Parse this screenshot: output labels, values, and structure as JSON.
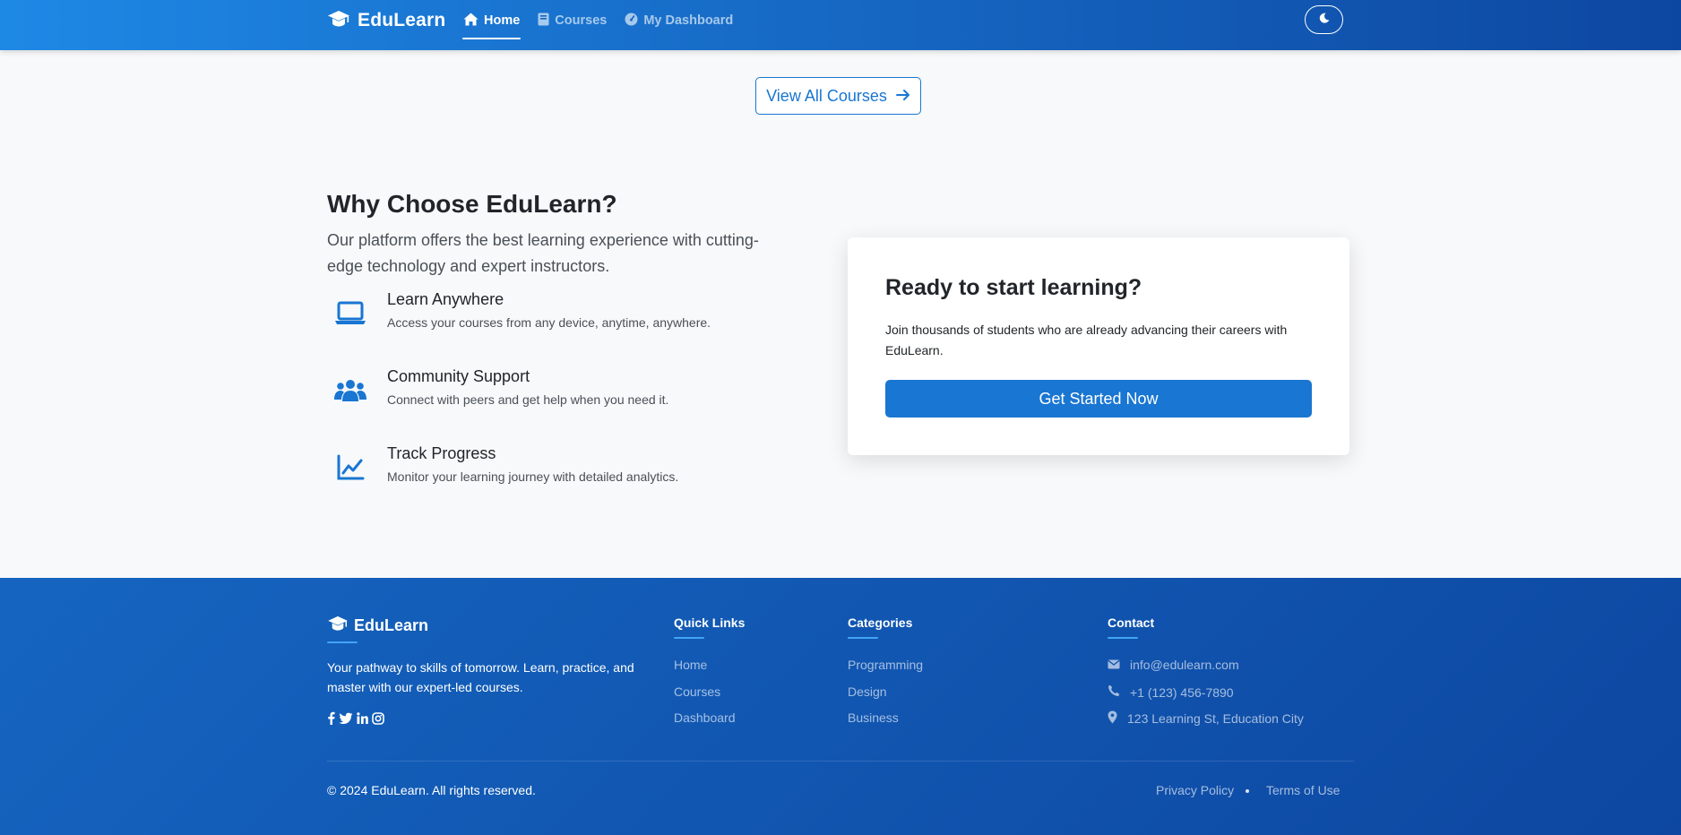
{
  "navbar": {
    "brand": "EduLearn",
    "links": [
      {
        "label": "Home",
        "icon": "home-icon",
        "active": true
      },
      {
        "label": "Courses",
        "icon": "book-icon",
        "active": false
      },
      {
        "label": "My Dashboard",
        "icon": "tachometer-icon",
        "active": false
      }
    ],
    "theme_toggle_icon": "moon-icon"
  },
  "view_all": {
    "label": "View All Courses",
    "icon": "arrow-right-icon"
  },
  "why": {
    "title": "Why Choose EduLearn?",
    "description": "Our platform offers the best learning experience with cutting-edge technology and expert instructors.",
    "features": [
      {
        "title": "Learn Anywhere",
        "description": "Access your courses from any device, anytime, anywhere.",
        "icon": "laptop-icon"
      },
      {
        "title": "Community Support",
        "description": "Connect with peers and get help when you need it.",
        "icon": "users-icon"
      },
      {
        "title": "Track Progress",
        "description": "Monitor your learning journey with detailed analytics.",
        "icon": "chart-line-icon"
      }
    ]
  },
  "cta": {
    "title": "Ready to start learning?",
    "description": "Join thousands of students who are already advancing their careers with EduLearn.",
    "button": "Get Started Now"
  },
  "footer": {
    "brand": "EduLearn",
    "tagline": "Your pathway to skills of tomorrow. Learn, practice, and master with our expert-led courses.",
    "social": [
      "facebook-icon",
      "twitter-icon",
      "linkedin-icon",
      "instagram-icon"
    ],
    "quick_links": {
      "heading": "Quick Links",
      "items": [
        "Home",
        "Courses",
        "Dashboard"
      ]
    },
    "categories": {
      "heading": "Categories",
      "items": [
        "Programming",
        "Design",
        "Business"
      ]
    },
    "contact": {
      "heading": "Contact",
      "email": "info@edulearn.com",
      "phone": "+1 (123) 456-7890",
      "address": "123 Learning St, Education City"
    },
    "copyright": "© 2024 EduLearn. All rights reserved.",
    "privacy": "Privacy Policy",
    "terms": "Terms of Use"
  },
  "colors": {
    "primary": "#1976d2",
    "nav_gradient_start": "#1e88e5",
    "nav_gradient_end": "#0d47a1",
    "footer_bg": "#1565c0",
    "accent_underline": "#42a5f5",
    "page_bg": "#f8f9fa"
  }
}
